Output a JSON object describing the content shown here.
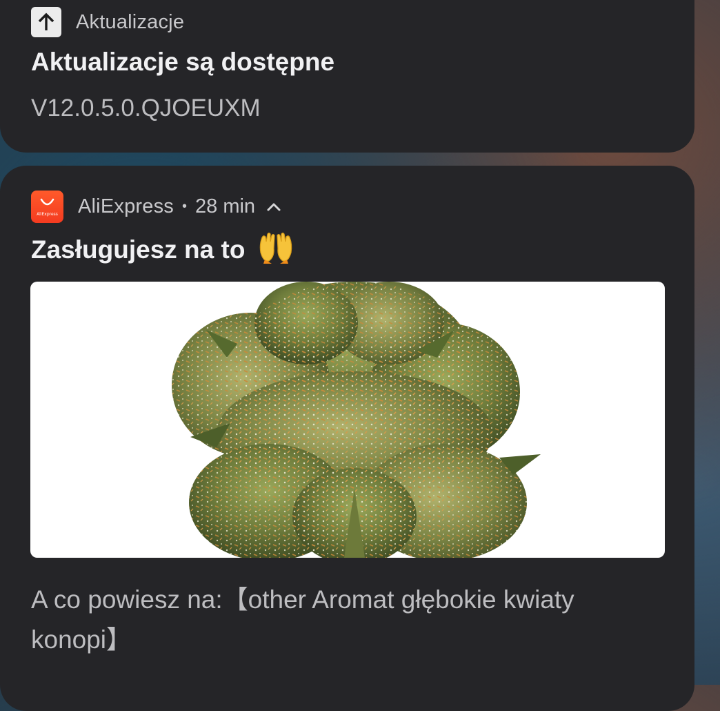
{
  "notifications": [
    {
      "app_name": "Aktualizacje",
      "icon": "upload-arrow-icon",
      "title": "Aktualizacje są dostępne",
      "text": "V12.0.5.0.QJOEUXM"
    },
    {
      "app_name": "AliExpress",
      "logo_text": "AliExpress",
      "icon": "aliexpress-logo-icon",
      "time": "28 min",
      "separator": "•",
      "title": "Zasługujesz na to",
      "title_emoji": "raising-hands-icon",
      "image": "cannabis-bud-photo",
      "text": "A co powiesz na:【other Aromat głębokie kwiaty konopi】"
    }
  ],
  "colors": {
    "card_background": "#252528",
    "title_text": "#f1f1f3",
    "secondary_text": "#bdbdc0",
    "aliexpress_red": "#f43b20"
  }
}
